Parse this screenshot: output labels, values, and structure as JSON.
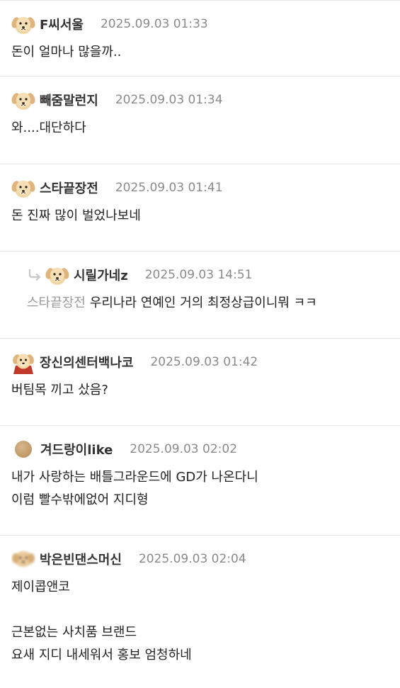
{
  "comments": [
    {
      "author": "F씨서울",
      "date": "2025.09.03 01:33",
      "lines": [
        "돈이 얼마나 많을까.."
      ]
    },
    {
      "author": "빼줌말런지",
      "date": "2025.09.03 01:34",
      "lines": [
        "와....대단하다"
      ]
    },
    {
      "author": "스타끝장전",
      "date": "2025.09.03 01:41",
      "lines": [
        "돈 진짜 많이 벌었나보네"
      ]
    },
    {
      "author": "시릴가네z",
      "date": "2025.09.03 14:51",
      "mention": "스타끝장전",
      "lines": [
        "우리나라 연예인 거의 최정상급이니뭐 ㅋㅋ"
      ],
      "is_reply": true
    },
    {
      "author": "장신의센터백나코",
      "date": "2025.09.03 01:42",
      "lines": [
        "버팀목 끼고 샀음?"
      ]
    },
    {
      "author": "겨드랑이like",
      "date": "2025.09.03 02:02",
      "lines": [
        "내가 사랑하는 배틀그라운드에 GD가 나온다니",
        "이럼 빨수밖에없어 지디형"
      ]
    },
    {
      "author": "박은빈댄스머신",
      "date": "2025.09.03 02:04",
      "lines": [
        "제이콥앤코",
        "",
        "근본없는 사치품 브랜드",
        "요새 지디 내세워서 홍보 엄청하네"
      ]
    }
  ],
  "icons": {
    "avatar": "puppy-avatar-icon",
    "reply": "reply-arrow-icon"
  },
  "colors": {
    "text": "#222222",
    "meta": "#8a8a8a",
    "mention": "#9a9a9a",
    "divider": "#e6e6e6"
  }
}
